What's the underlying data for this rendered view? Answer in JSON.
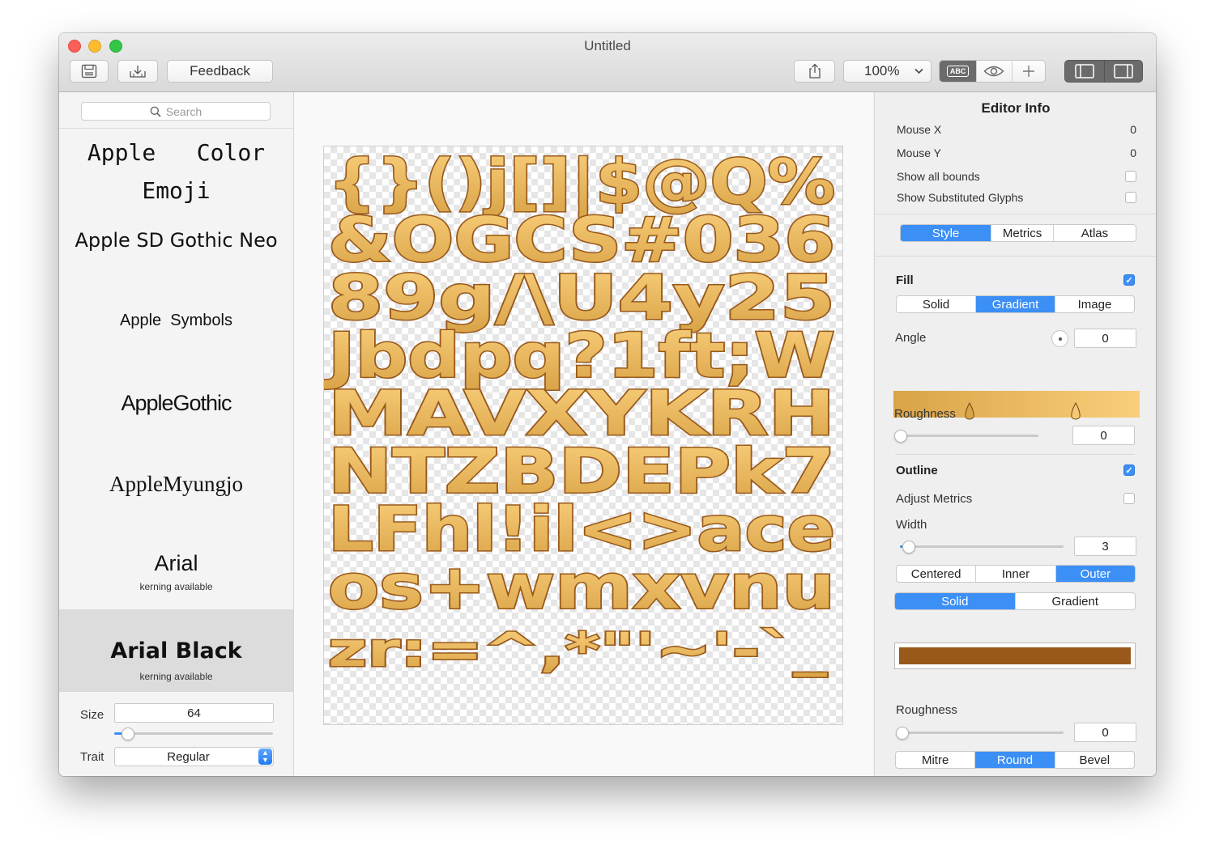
{
  "window": {
    "title": "Untitled"
  },
  "toolbar": {
    "save_icon": "save-icon",
    "export_icon": "export-icon",
    "feedback_label": "Feedback",
    "share_icon": "share-icon",
    "zoom_value": "100%",
    "abc_label": "ABC",
    "preview_icon": "eye-icon",
    "add_icon": "plus-icon"
  },
  "sidebar": {
    "search_placeholder": "Search",
    "fonts": [
      {
        "name": "Apple   Color Emoji",
        "sub": ""
      },
      {
        "name": "Apple SD Gothic Neo",
        "sub": ""
      },
      {
        "name": "Apple  Symbols",
        "sub": ""
      },
      {
        "name": "AppleGothic",
        "sub": ""
      },
      {
        "name": "AppleMyungjo",
        "sub": ""
      },
      {
        "name": "Arial",
        "sub": "kerning available"
      },
      {
        "name": "Arial Black",
        "sub": "kerning available"
      }
    ],
    "selected_font": "Arial Black",
    "size_label": "Size",
    "size_value": "64",
    "size_slider_fraction": 0.08,
    "trait_label": "Trait",
    "trait_value": "Regular"
  },
  "atlas": {
    "rows": [
      "{}()j[]|$@Q%",
      "&OGCS#036",
      "89g/\\U4y25",
      "Jbdpq?1ft;W",
      "MAVXYKRH",
      "NTZBDEPk7",
      "LFhl!il<>ace",
      "os+wmxvnu",
      "zr:=^,*\"'~'-`_"
    ],
    "fill_top": "#f9cf7b",
    "fill_bottom": "#d9a347",
    "outline_color": "#98591b"
  },
  "inspector": {
    "title": "Editor Info",
    "mouse_x_label": "Mouse X",
    "mouse_x_value": "0",
    "mouse_y_label": "Mouse Y",
    "mouse_y_value": "0",
    "show_bounds_label": "Show all bounds",
    "show_substituted_label": "Show Substituted Glyphs",
    "tabs": [
      "Style",
      "Metrics",
      "Atlas"
    ],
    "active_tab": "Style",
    "fill": {
      "title": "Fill",
      "enabled": true,
      "modes": [
        "Solid",
        "Gradient",
        "Image"
      ],
      "active_mode": "Gradient",
      "angle_label": "Angle",
      "angle_value": "0",
      "gradient_start": "#d9a347",
      "gradient_end": "#f9cf7b",
      "roughness_label": "Roughness",
      "roughness_value": "0"
    },
    "outline": {
      "title": "Outline",
      "enabled": true,
      "adjust_metrics_label": "Adjust Metrics",
      "width_label": "Width",
      "width_value": "3",
      "positions": [
        "Centered",
        "Inner",
        "Outer"
      ],
      "active_position": "Outer",
      "modes": [
        "Solid",
        "Gradient"
      ],
      "active_mode": "Solid",
      "color": "#98591b",
      "roughness_label": "Roughness",
      "roughness_value": "0",
      "joins": [
        "Mitre",
        "Round",
        "Bevel"
      ],
      "active_join": "Round"
    },
    "accent_color": "#3b8ff5"
  }
}
